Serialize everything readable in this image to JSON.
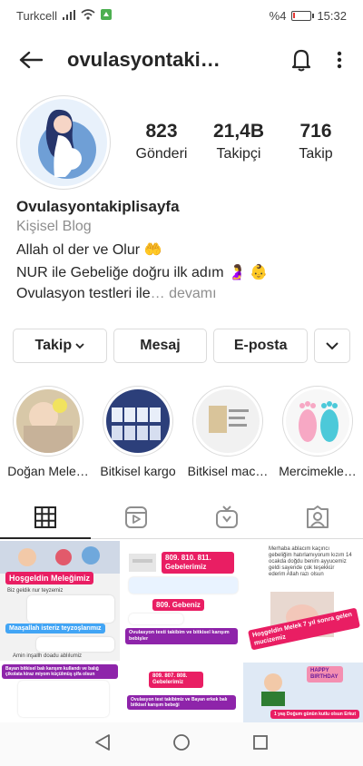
{
  "status": {
    "carrier": "Turkcell",
    "battery_text": "%4",
    "time": "15:32",
    "battery_level": 0.04,
    "battery_color": "#e53935"
  },
  "topbar": {
    "back_icon": "arrow-left-icon",
    "title": "ovulasyontaki…",
    "bell_icon": "bell-icon",
    "menu_icon": "more-vertical-icon"
  },
  "profile": {
    "posts_count": "823",
    "posts_label": "Gönderi",
    "followers_count": "21,4B",
    "followers_label": "Takipçi",
    "following_count": "716",
    "following_label": "Takip"
  },
  "bio": {
    "name": "Ovulasyontakiplisayfa",
    "category": "Kişisel Blog",
    "line1": "Allah ol der ve Olur 🤲",
    "line2": "NUR ile Gebeliğe doğru ilk adım 🤰 👶",
    "line3": "Ovulasyon testleri ile",
    "more": "… devamı"
  },
  "actions": {
    "follow": "Takip",
    "message": "Mesaj",
    "email": "E-posta",
    "dropdown_icon": "chevron-down-icon"
  },
  "highlights": [
    {
      "label": "Doğan Mele…"
    },
    {
      "label": "Bitkisel kargo"
    },
    {
      "label": "Bitkisel mac…"
    },
    {
      "label": "Mercimekle…"
    }
  ],
  "tabs": [
    {
      "icon": "grid-icon",
      "active": true
    },
    {
      "icon": "reels-icon",
      "active": false
    },
    {
      "icon": "igtv-icon",
      "active": false
    },
    {
      "icon": "tagged-icon",
      "active": false
    }
  ],
  "posts": {
    "p1": {
      "tag": "Hoşgeldin Meleğimiz",
      "small": "Biz geldik nur teyzemiz",
      "tag2": "Maaşallah isteriz teyzoşlarımız",
      "foot": "Amin inşallh doadu ablılumiz"
    },
    "p2": {
      "tag": "809. 810. 811. Gebelerimiz",
      "tag2": "809. Gebeniz",
      "bar": "Ovulasyon testi takibim ve bitkisel karışım bebişler"
    },
    "p3": {
      "msg": "Merhaba ablacım kaçıncı gebeliğim hatırlamıyorum kızım 14 ocakda doğdu benim ayyucemiz geldi sayende çok teşekkür ederim Allah razı olsun",
      "tag": "Hoşgeldin Melek 7 yıl sonra gelen mucizemiz"
    },
    "p4": {
      "tag": "Bayan bitkisel balı karışım kullandı ve balığ çikolata kiraz miyom küçülmüş şifa olsun"
    },
    "p5": {
      "tag": "809. 807. 808. Gebelerimiz",
      "bar": "Ovulasyon test takibimiz ve Bayan erkek balı bitkisel karışım bebeği"
    },
    "p6": {
      "happy": "HAPPY BIRTHDAY",
      "tag": "1 yaş Doğum günün kutlu olsun Erkut"
    }
  },
  "colors": {
    "pink": "#e91e63",
    "purple": "#8e24aa",
    "blue": "#42a5f5",
    "red": "#e53935"
  }
}
